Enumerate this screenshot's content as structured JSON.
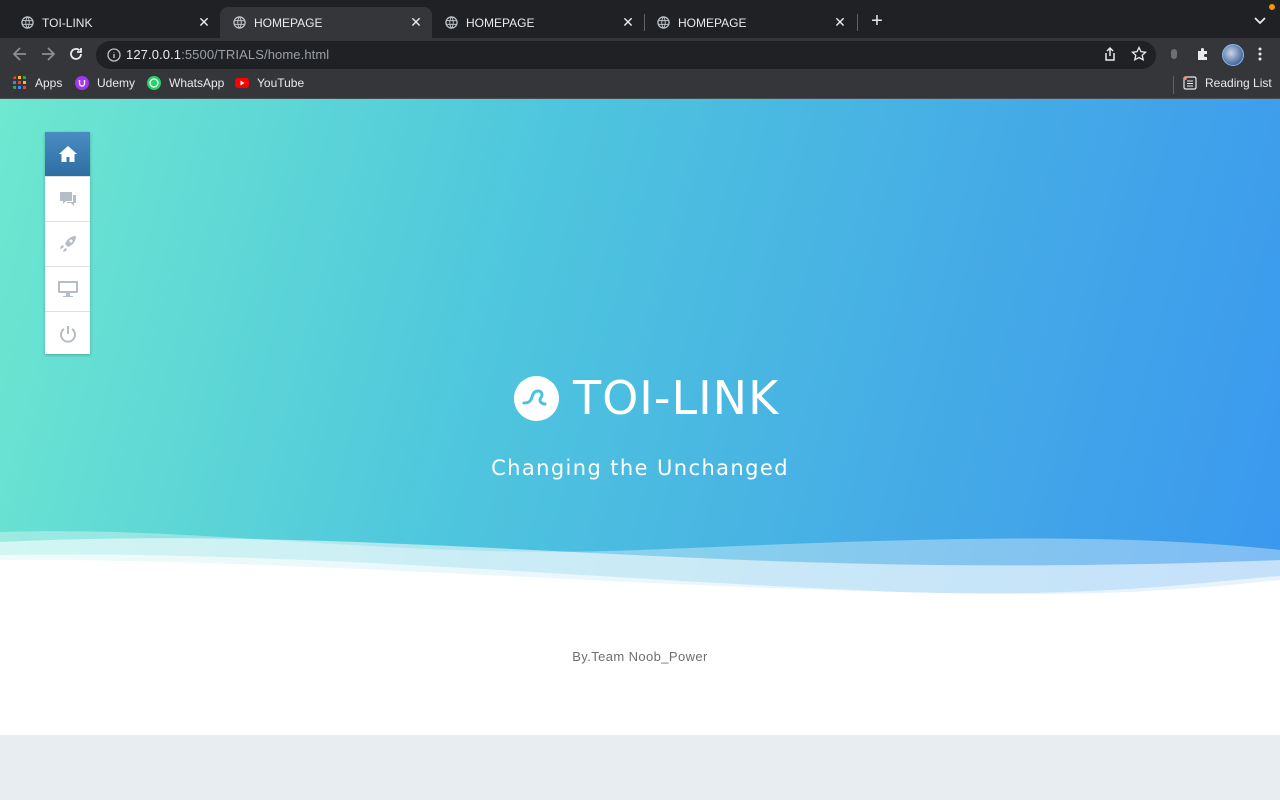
{
  "browser": {
    "tabs": [
      {
        "title": "TOI-LINK",
        "active": false
      },
      {
        "title": "HOMEPAGE",
        "active": true
      },
      {
        "title": "HOMEPAGE",
        "active": false
      },
      {
        "title": "HOMEPAGE",
        "active": false
      }
    ],
    "url_host": "127.0.0.1",
    "url_rest": ":5500/TRIALS/home.html",
    "bookmarks": [
      {
        "label": "Apps",
        "icon": "apps-grid-icon"
      },
      {
        "label": "Udemy",
        "icon": "udemy-icon",
        "color": "#a435f0"
      },
      {
        "label": "WhatsApp",
        "icon": "whatsapp-icon",
        "color": "#25d366"
      },
      {
        "label": "YouTube",
        "icon": "youtube-icon",
        "color": "#ff0000"
      }
    ],
    "reading_list": "Reading List"
  },
  "page": {
    "sidenav": [
      {
        "name": "home",
        "icon": "home-icon",
        "active": true
      },
      {
        "name": "chat",
        "icon": "chat-icon",
        "active": false
      },
      {
        "name": "launch",
        "icon": "rocket-icon",
        "active": false
      },
      {
        "name": "display",
        "icon": "monitor-icon",
        "active": false
      },
      {
        "name": "power",
        "icon": "power-icon",
        "active": false
      }
    ],
    "brand": "TOI-LINK",
    "tagline": "Changing the Unchanged",
    "footer": "By.Team Noob_Power",
    "colors": {
      "gradient_start": "#6ee8cf",
      "gradient_end": "#3a98ef",
      "nav_active": "#3a7db3"
    }
  }
}
